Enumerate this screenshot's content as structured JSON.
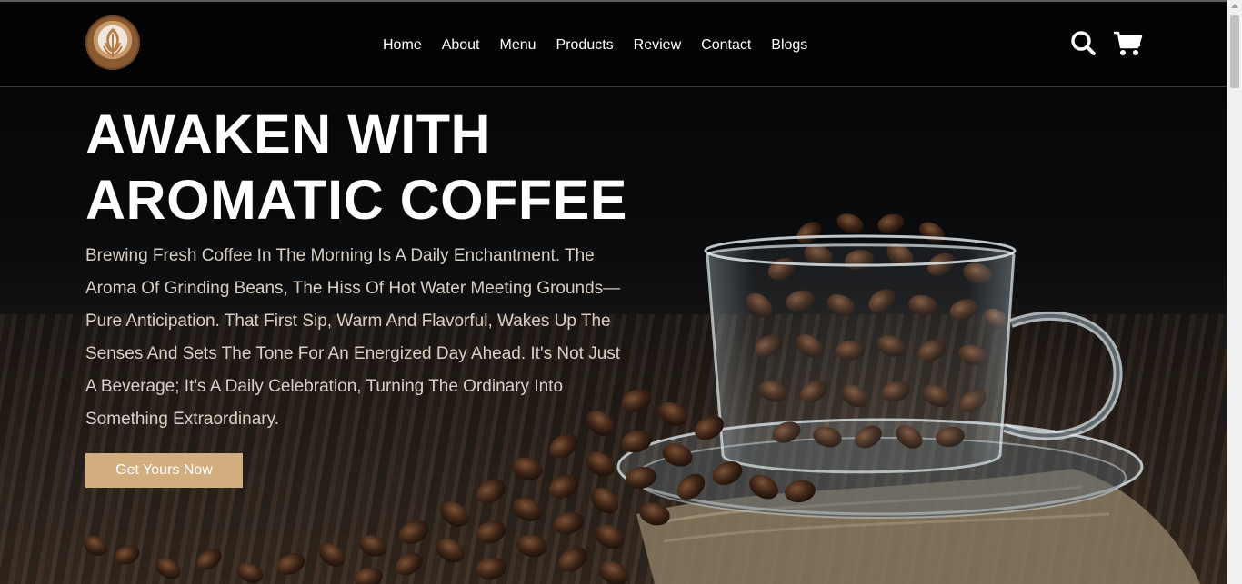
{
  "header": {
    "logo_name": "latte-art-logo",
    "nav": [
      "Home",
      "About",
      "Menu",
      "Products",
      "Review",
      "Contact",
      "Blogs"
    ],
    "icons": [
      "search-icon",
      "cart-icon"
    ]
  },
  "hero": {
    "title_line1": "AWAKEN WITH",
    "title_line2": "AROMATIC COFFEE",
    "description": "Brewing Fresh Coffee In The Morning Is A Daily Enchantment. The Aroma Of Grinding Beans, The Hiss Of Hot Water Meeting Grounds—Pure Anticipation. That First Sip, Warm And Flavorful, Wakes Up The Senses And Sets The Tone For An Energized Day Ahead. It's Not Just A Beverage; It's A Daily Celebration, Turning The Ordinary Into Something Extraordinary.",
    "cta_label": "Get Yours Now"
  },
  "colors": {
    "accent": "#d2ae7e",
    "header_bg": "#030303",
    "text": "#ffffff"
  }
}
